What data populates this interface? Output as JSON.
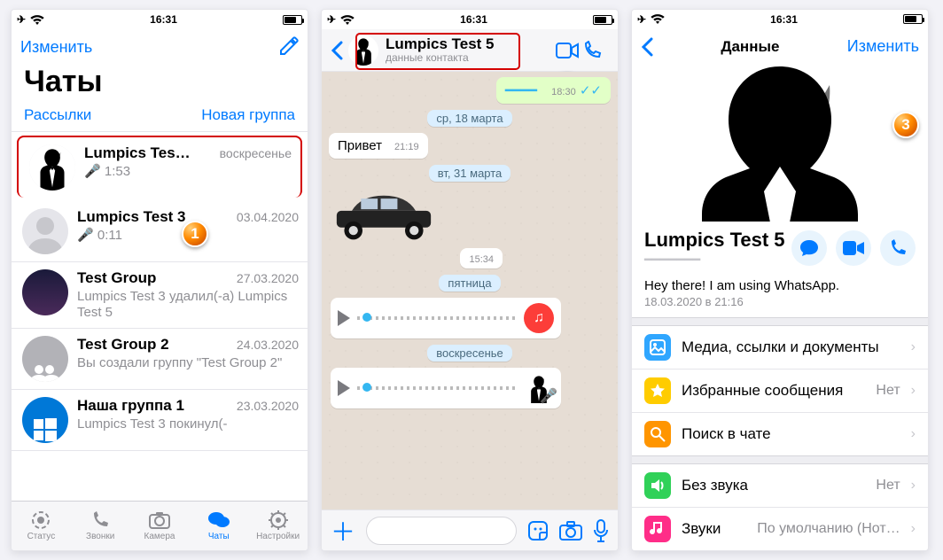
{
  "status_time": "16:31",
  "s1": {
    "edit": "Изменить",
    "title": "Чаты",
    "broadcast": "Рассылки",
    "newgroup": "Новая группа",
    "chats": [
      {
        "name": "Lumpics Tes…",
        "date": "воскресенье",
        "snippet": "1:53",
        "type": "voice"
      },
      {
        "name": "Lumpics Test 3",
        "date": "03.04.2020",
        "snippet": "0:11",
        "type": "voice"
      },
      {
        "name": "Test Group",
        "date": "27.03.2020",
        "snippet": "Lumpics Test 3 удалил(-а) Lumpics Test 5",
        "type": "text"
      },
      {
        "name": "Test Group 2",
        "date": "24.03.2020",
        "snippet": "Вы создали группу \"Test Group 2\"",
        "type": "text"
      },
      {
        "name": "Наша группа 1",
        "date": "23.03.2020",
        "snippet": "Lumpics Test 3 покинул(-",
        "type": "text"
      }
    ],
    "tabs": [
      "Статус",
      "Звонки",
      "Камера",
      "Чаты",
      "Настройки"
    ]
  },
  "s2": {
    "contact_name": "Lumpics Test 5",
    "contact_sub": "данные контакта",
    "msg_time_out": "18:30",
    "date1": "ср, 18 марта",
    "msg1": "Привет",
    "msg1_time": "21:19",
    "date2": "вт, 31 марта",
    "sticker_time": "15:34",
    "date3": "пятница",
    "date4": "воскресенье"
  },
  "s3": {
    "title": "Данные",
    "edit": "Изменить",
    "name": "Lumpics Test 5",
    "status": "Hey there! I am using WhatsApp.",
    "status_date": "18.03.2020 в 21:16",
    "items": [
      {
        "icon": "#2fa6ff",
        "label": "Медиа, ссылки и документы"
      },
      {
        "icon": "#ffcc00",
        "label": "Избранные сообщения",
        "value": "Нет"
      },
      {
        "icon": "#ff9500",
        "label": "Поиск в чате"
      }
    ],
    "items2": [
      {
        "icon": "#30d158",
        "label": "Без звука",
        "value": "Нет"
      },
      {
        "icon": "#ff2d88",
        "label": "Звуки",
        "value": "По умолчанию (Нот…"
      }
    ]
  }
}
